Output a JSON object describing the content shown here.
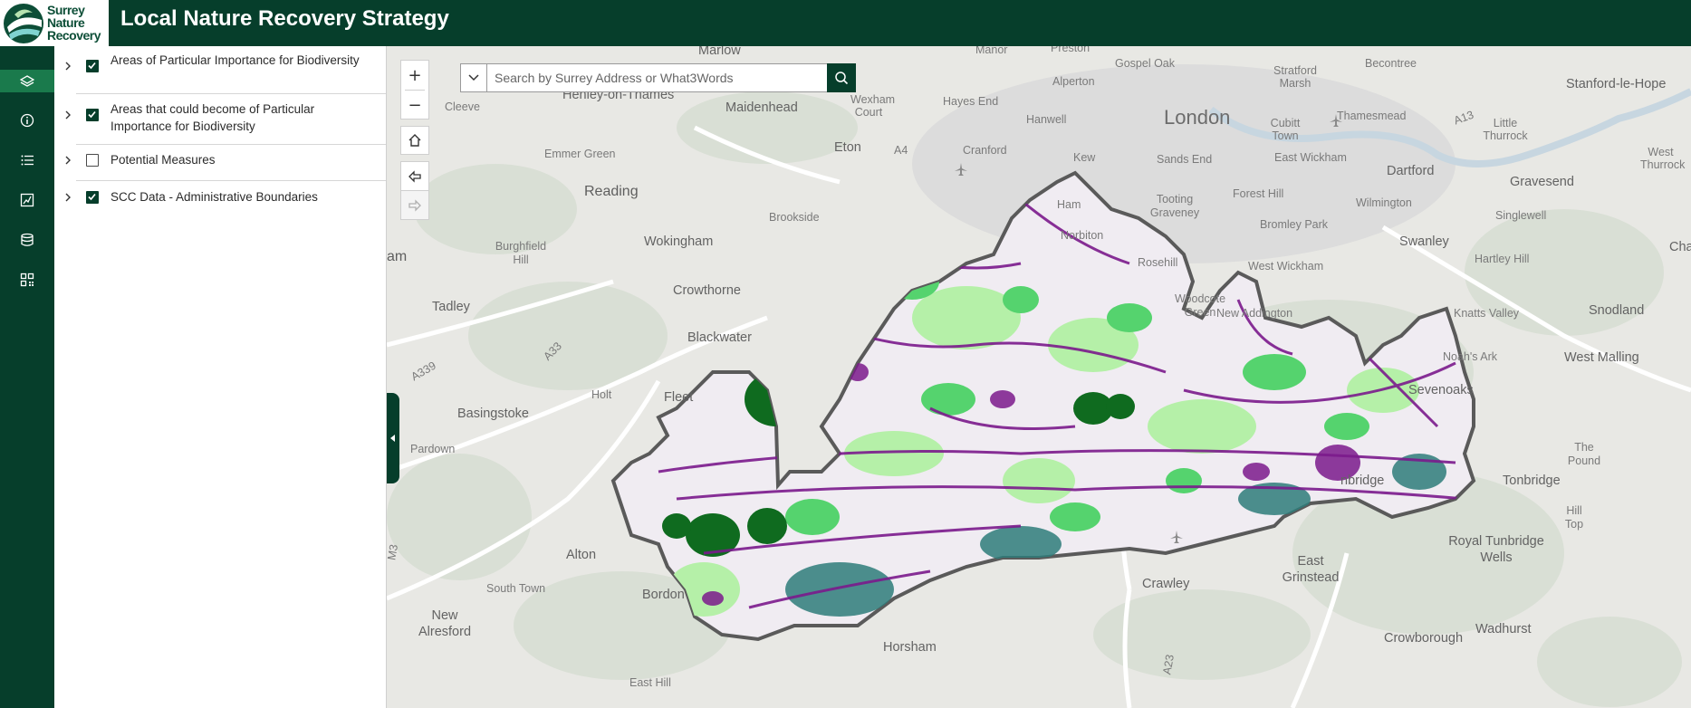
{
  "header": {
    "logo_lines": [
      "Surrey",
      "Nature",
      "Recovery"
    ],
    "title": "Local Nature Recovery Strategy"
  },
  "side_rail": {
    "items": [
      {
        "icon": "layers-icon",
        "active": true
      },
      {
        "icon": "info-icon",
        "active": false
      },
      {
        "icon": "legend-list-icon",
        "active": false
      },
      {
        "icon": "chart-icon",
        "active": false
      },
      {
        "icon": "database-icon",
        "active": false
      },
      {
        "icon": "qr-code-icon",
        "active": false
      }
    ]
  },
  "layers": [
    {
      "label": "Areas of Particular Importance for Biodiversity",
      "checked": true
    },
    {
      "label": "Areas that could become of Particular Importance for Biodiversity",
      "checked": true
    },
    {
      "label": "Potential Measures",
      "checked": false
    },
    {
      "label": "SCC Data - Administrative Boundaries",
      "checked": true
    }
  ],
  "map_controls": {
    "zoom_in": "+",
    "zoom_out": "−"
  },
  "search": {
    "placeholder": "Search by Surrey Address or What3Words"
  },
  "colors": {
    "header_bg": "#063e2b",
    "active_rail": "#1a7a4c",
    "purple_habitat": "#7b1a8c",
    "green_habitat": "#4fd16a",
    "dark_green_habitat": "#0f6b1f",
    "light_green_habitat": "#a7f09a",
    "teal_habitat": "#2e7d7a",
    "boundary": "#5a5a5a"
  },
  "map_labels": {
    "marlow": "Marlow",
    "manor": "Manor",
    "preston": "Preston",
    "gospel_oak": "Gospel Oak",
    "stratford_marsh": "Stratford Marsh",
    "becontree": "Becontree",
    "stanford_le_hope": "Stanford-le-Hope",
    "henley": "Henley-on-Thames",
    "maidenhead": "Maidenhead",
    "wexham_court": "Wexham Court",
    "hayes_end": "Hayes End",
    "hanwell": "Hanwell",
    "alperton": "Alperton",
    "london": "London",
    "cubitt_town": "Cubitt Town",
    "thamesmead": "Thamesmead",
    "little_thurrock": "Little Thurrock",
    "west_thurrock": "West Thurrock",
    "cleeve": "Cleeve",
    "eton": "Eton",
    "cranford": "Cranford",
    "kew": "Kew",
    "sands_end": "Sands End",
    "east_wickham": "East Wickham",
    "dartford": "Dartford",
    "gravesend": "Gravesend",
    "emmer_green": "Emmer Green",
    "reading": "Reading",
    "ham": "Ham",
    "tooting_graveney": "Tooting Graveney",
    "forest_hill": "Forest Hill",
    "wilmington": "Wilmington",
    "singlewell": "Singlewell",
    "brookside": "Brookside",
    "norbiton": "Norbiton",
    "bromley_park": "Bromley Park",
    "swanley": "Swanley",
    "chat": "Chat",
    "wokingham": "Wokingham",
    "burghfield_hill": "Burghfield Hill",
    "rosehill": "Rosehill",
    "west_wickham": "West Wickham",
    "hartley_hill": "Hartley Hill",
    "crowthorne": "Crowthorne",
    "am": "am",
    "tadley": "Tadley",
    "woodcote_green": "Woodcote Green",
    "new_addington": "New Addington",
    "knatts_valley": "Knatts Valley",
    "snodland": "Snodland",
    "blackwater": "Blackwater",
    "noahs_ark": "Noah's Ark",
    "west_malling": "West Malling",
    "a33": "A33",
    "a339": "A339",
    "holt": "Holt",
    "fleet": "Fleet",
    "sevenoaks": "Sevenoaks",
    "basingstoke": "Basingstoke",
    "pardown": "Pardown",
    "the_pound": "The Pound",
    "tonbridge": "Tonbridge",
    "nbridge": "nbridge",
    "hill_top": "Hill Top",
    "royal_tunbridge_wells": "Royal Tunbridge Wells",
    "m3": "M3",
    "alton": "Alton",
    "south_town": "South Town",
    "crawley": "Crawley",
    "east_grinstead": "East Grinstead",
    "bordon": "Bordon",
    "new_alresford": "New Alresford",
    "horsham": "Horsham",
    "wadhurst": "Wadhurst",
    "crowborough": "Crowborough",
    "a23": "A23",
    "east_hill": "East Hill",
    "a13": "A13",
    "a4": "A4"
  }
}
